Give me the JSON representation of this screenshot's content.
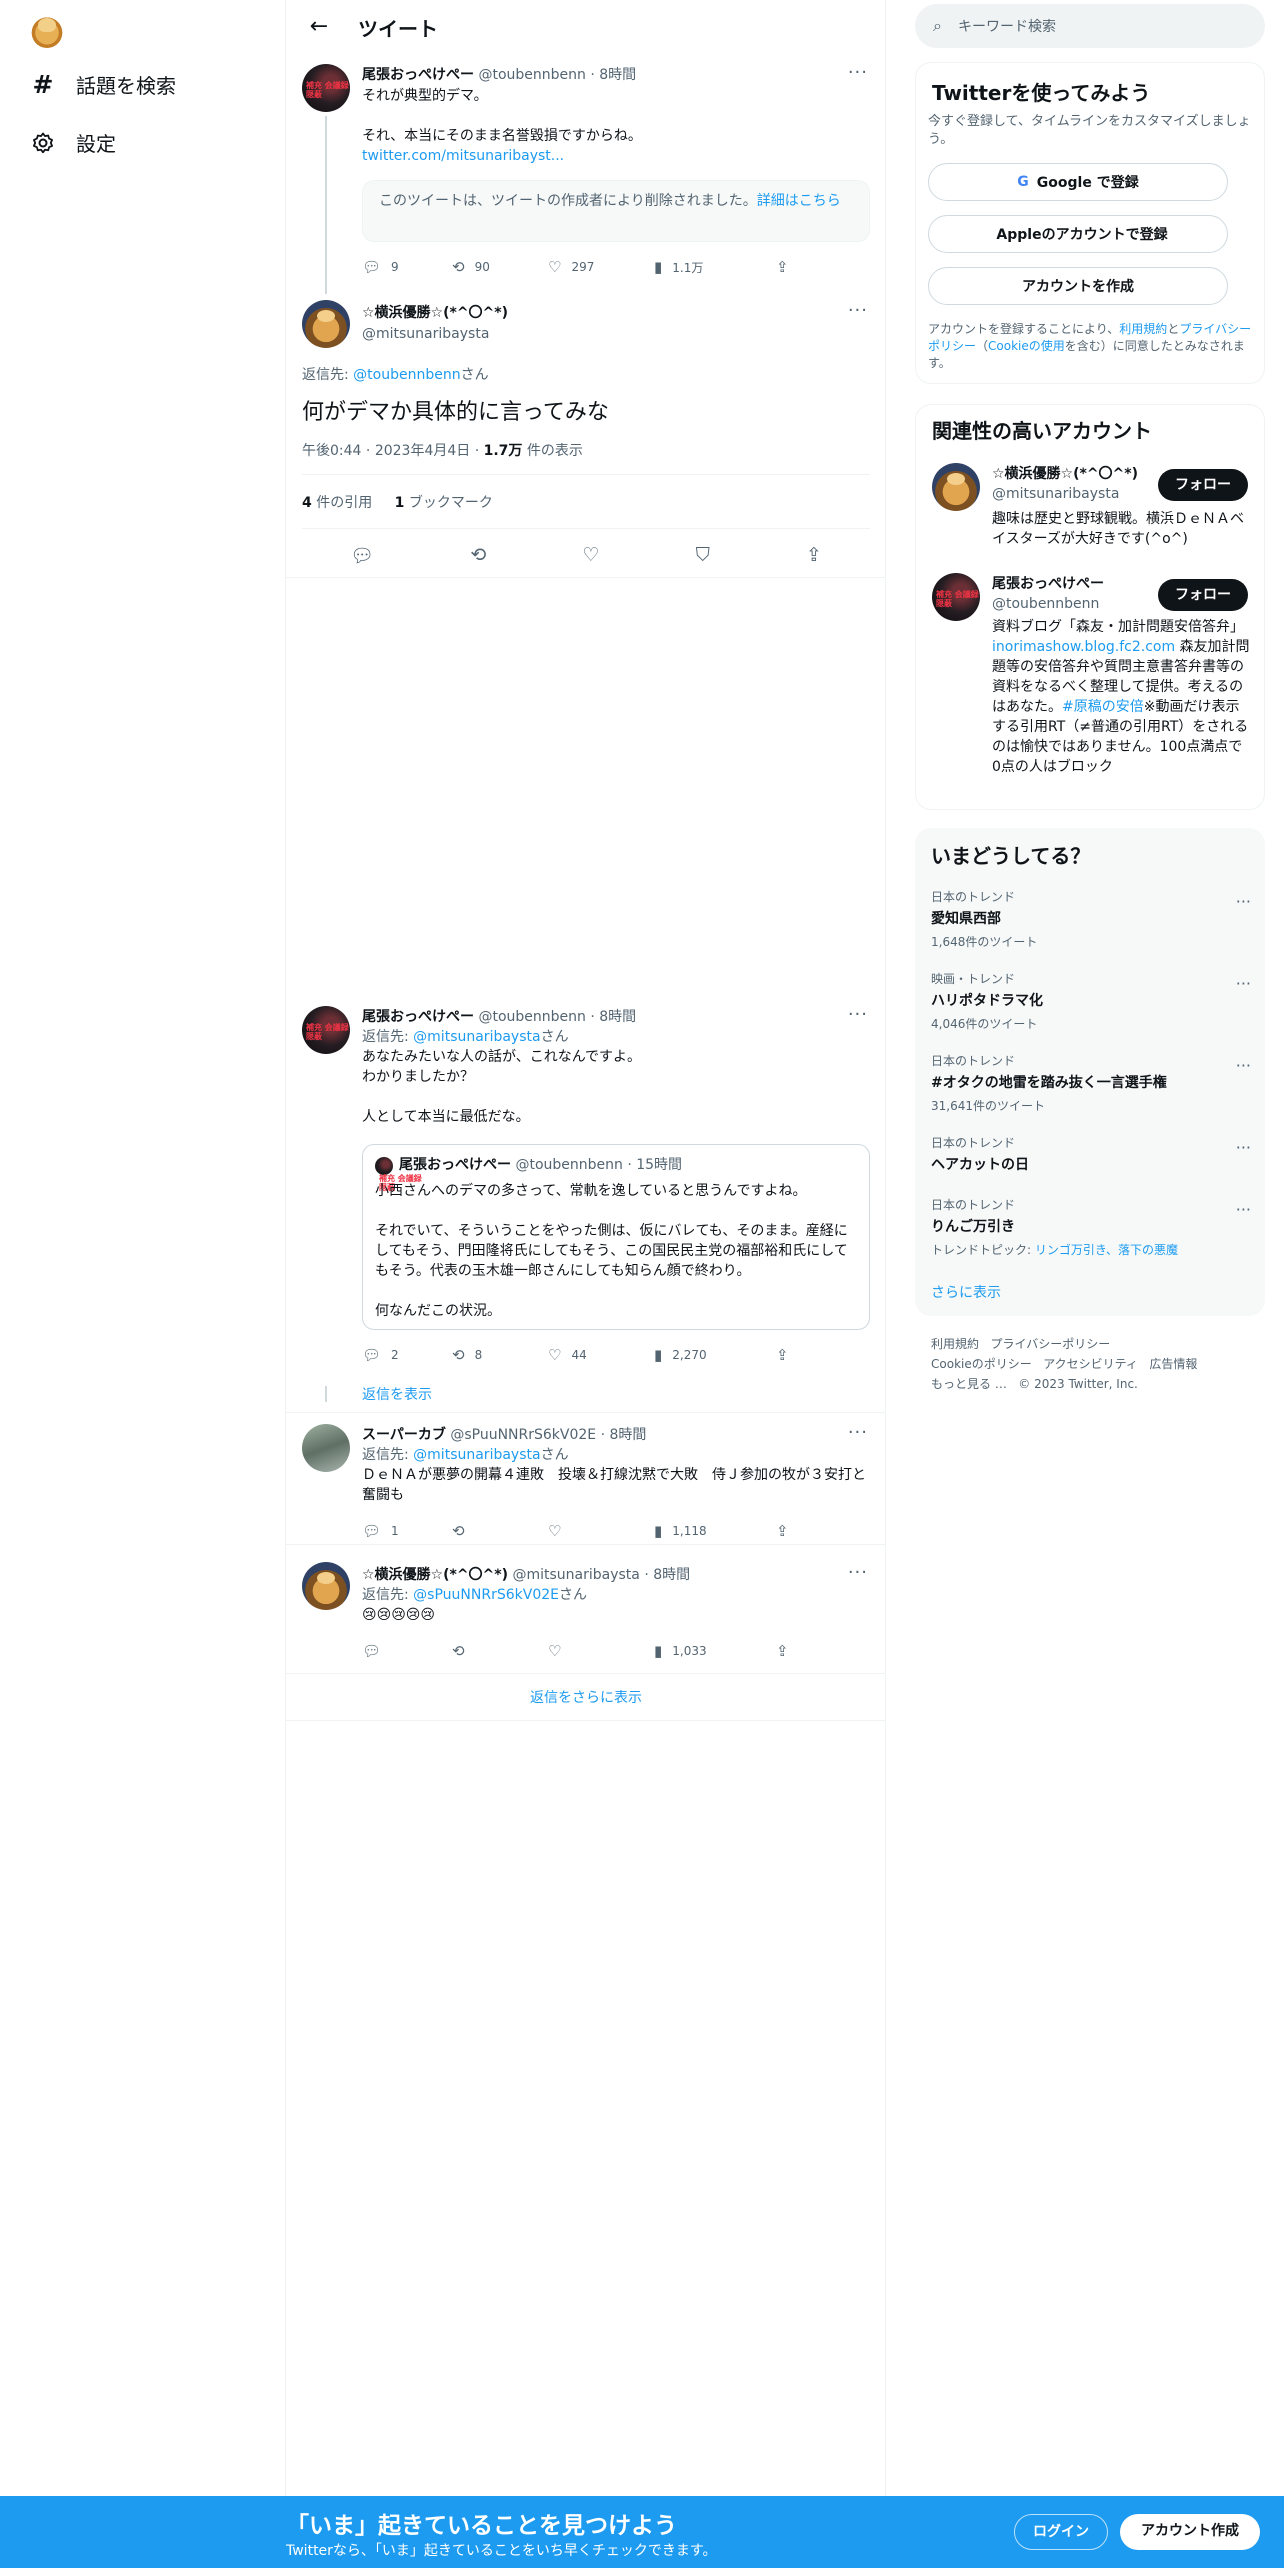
{
  "nav": {
    "explore": "話題を検索",
    "settings": "設定"
  },
  "header": {
    "title": "ツイート"
  },
  "tweet1": {
    "name": "尾張おっぺけぺー",
    "handle": "@toubennbenn",
    "time": "8時間",
    "line1": "それが典型的デマ。",
    "line2": "それ、本当にそのまま名誉毀損ですからね。",
    "link": "twitter.com/mitsunaribayst...",
    "deleted_notice": "このツイートは、ツイートの作成者により削除されました。",
    "deleted_link": "詳細はこちら",
    "replies": "9",
    "retweets": "90",
    "likes": "297",
    "views": "1.1万"
  },
  "main_tweet": {
    "name": "☆横浜優勝☆(*^〇^*)",
    "handle": "@mitsunaribaysta",
    "reply_to_prefix": "返信先: ",
    "reply_to": "@toubennbenn",
    "reply_to_suffix": "さん",
    "text": "何がデマか具体的に言ってみな",
    "time": "午後0:44",
    "date": "2023年4月4日",
    "views": "1.7万",
    "views_label": "件の表示",
    "quotes": "4",
    "quotes_label": "件の引用",
    "bookmarks": "1",
    "bookmarks_label": "ブックマーク"
  },
  "tweet3": {
    "name": "尾張おっぺけぺー",
    "handle": "@toubennbenn",
    "time": "8時間",
    "reply_to_prefix": "返信先: ",
    "reply_to": "@mitsunaribaysta",
    "reply_to_suffix": "さん",
    "line1": "あなたみたいな人の話が、これなんですよ。",
    "line2": "わかりましたか？",
    "line3": "人として本当に最低だな。",
    "quote": {
      "name": "尾張おっぺけぺー",
      "handle": "@toubennbenn",
      "time": "15時間",
      "p1": "小西さんへのデマの多さって、常軌を逸していると思うんですよね。",
      "p2": "それでいて、そういうことをやった側は、仮にバレても、そのまま。産経にしてもそう、門田隆将氏にしてもそう、この国民民主党の福部裕和氏にしてもそう。代表の玉木雄一郎さんにしても知らん顔で終わり。",
      "p3": "何なんだこの状況。"
    },
    "replies": "2",
    "retweets": "8",
    "likes": "44",
    "views": "2,270",
    "show_replies": "返信を表示"
  },
  "tweet4": {
    "name": "スーパーカブ",
    "handle": "@sPuuNNRrS6kV02E",
    "time": "8時間",
    "reply_to_prefix": "返信先: ",
    "reply_to": "@mitsunaribaysta",
    "reply_to_suffix": "さん",
    "text": "ＤｅＮＡが悪夢の開幕４連敗　投壊＆打線沈黙で大敗　侍Ｊ参加の牧が３安打と奮闘も",
    "replies": "1",
    "views": "1,118"
  },
  "tweet5": {
    "name": "☆横浜優勝☆(*^〇^*)",
    "handle": "@mitsunaribaysta",
    "time": "8時間",
    "reply_to_prefix": "返信先: ",
    "reply_to": "@sPuuNNRrS6kV02E",
    "reply_to_suffix": "さん",
    "text": "😢😢😢😢😢",
    "views": "1,033"
  },
  "more_replies": "返信をさらに表示",
  "search": {
    "placeholder": "キーワード検索"
  },
  "signup": {
    "title": "Twitterを使ってみよう",
    "subtitle": "今すぐ登録して、タイムラインをカスタマイズしましょう。",
    "google": "Google で登録",
    "apple": "Appleのアカウントで登録",
    "create": "アカウントを作成",
    "legal_1": "アカウントを登録することにより、",
    "legal_terms": "利用規約",
    "legal_and": "と",
    "legal_privacy": "プライバシーポリシー",
    "legal_2": "（",
    "legal_cookie": "Cookieの使用",
    "legal_3": "を含む）に同意したとみなされます。"
  },
  "relevant": {
    "title": "関連性の高いアカウント",
    "follow": "フォロー",
    "acc1": {
      "name": "☆横浜優勝☆(*^〇^*)",
      "handle": "@mitsunaribaysta",
      "bio": "趣味は歴史と野球観戦。横浜ＤｅＮＡベイスターズが大好きです(^o^)"
    },
    "acc2": {
      "name": "尾張おっぺけぺー",
      "handle": "@toubennbenn",
      "bio1": "資料ブログ「森友・加計問題安倍答弁」",
      "bio_link": "inorimashow.blog.fc2.com",
      "bio2": "森友加計問題等の安倍答弁や質問主意書答弁書等の資料をなるべく整理して提供。考えるのはあなた。",
      "bio_tag": "#原稿の安倍",
      "bio3": "※動画だけ表示する引用RT（≠普通の引用RT）をされるのは愉快ではありません。100点満点で0点の人はブロック"
    }
  },
  "trends": {
    "title": "いまどうしてる？",
    "items": [
      {
        "cat": "日本のトレンド",
        "name": "愛知県西部",
        "count": "1,648件のツイート"
      },
      {
        "cat": "映画・トレンド",
        "name": "ハリポタドラマ化",
        "count": "4,046件のツイート"
      },
      {
        "cat": "日本のトレンド",
        "name": "#オタクの地雷を踏み抜く一言選手権",
        "count": "31,641件のツイート"
      },
      {
        "cat": "日本のトレンド",
        "name": "ヘアカットの日",
        "count": ""
      },
      {
        "cat": "日本のトレンド",
        "name": "りんご万引き",
        "count": "",
        "topic_prefix": "トレンドトピック: ",
        "topic": "リンゴ万引き、落下の悪魔"
      }
    ],
    "show_more": "さらに表示"
  },
  "footer": {
    "terms": "利用規約",
    "privacy": "プライバシーポリシー",
    "cookie": "Cookieのポリシー",
    "accessibility": "アクセシビリティ",
    "ads": "広告情報",
    "more": "もっと見る …",
    "copy": "© 2023 Twitter, Inc."
  },
  "banner": {
    "title": "「いま」起きていることを見つけよう",
    "subtitle": "Twitterなら、「いま」起きていることをいち早くチェックできます。",
    "login": "ログイン",
    "signup": "アカウント作成"
  }
}
